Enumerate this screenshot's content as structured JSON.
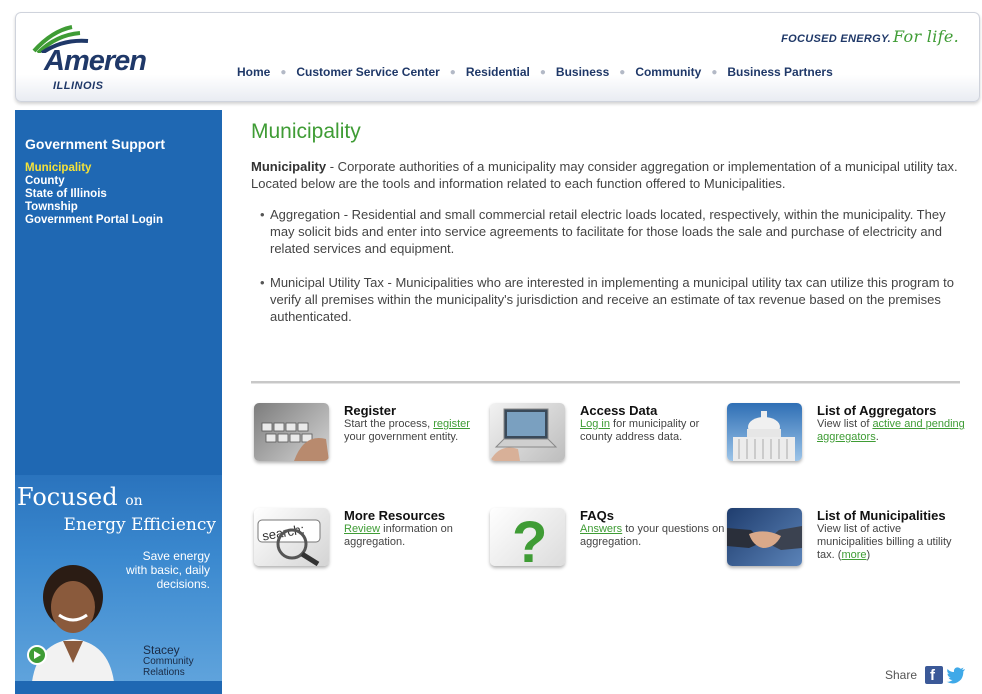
{
  "header": {
    "logo_text": "Ameren",
    "logo_sub": "ILLINOIS",
    "tagline": "FOCUSED ENERGY.",
    "tagline_script": "For life.",
    "nav": [
      "Home",
      "Customer Service Center",
      "Residential",
      "Business",
      "Community",
      "Business Partners"
    ]
  },
  "sidebar": {
    "title": "Government Support",
    "items": [
      "Municipality",
      "County",
      "State of Illinois",
      "Township",
      "Government Portal Login"
    ],
    "promo": {
      "focused": "Focused",
      "on": "on",
      "energy_efficiency": "Energy Efficiency",
      "save_line1": "Save energy",
      "save_line2": "with basic, daily",
      "save_line3": "decisions.",
      "name": "Stacey",
      "role": "Community Relations"
    }
  },
  "main": {
    "title": "Municipality",
    "intro_bold": "Municipality",
    "intro_text": " - Corporate authorities of a municipality may consider aggregation or implementation of a municipal utility tax.  Located below are the tools and information related to each function offered to Municipalities.",
    "bullets": [
      "Aggregation - Residential and small commercial retail electric loads located, respectively, within the municipality.  They may solicit bids and enter into service agreements to facilitate for those loads the sale and purchase of electricity and related services and equipment.",
      "Municipal Utility Tax - Municipalities who are interested in implementing a municipal utility tax can utilize this program to verify all premises within the municipality's jurisdiction and receive an estimate of tax revenue based on the premises authenticated."
    ]
  },
  "tiles": {
    "register": {
      "title": "Register",
      "pre": "Start the process, ",
      "link": "register",
      "post": " your government entity."
    },
    "access": {
      "title": "Access Data",
      "link": "Log in",
      "post": " for municipality or county address data."
    },
    "aggregators": {
      "title": "List of Aggregators",
      "pre": "View list of ",
      "link": "active and pending aggregators",
      "post": "."
    },
    "resources": {
      "title": "More Resources",
      "link": "Review",
      "post": " information on aggregation."
    },
    "faqs": {
      "title": "FAQs",
      "link": "Answers",
      "post": " to your questions on aggregation."
    },
    "municipalities": {
      "title": "List of Municipalities",
      "pre": "View list of active municipalities billing a utility tax. (",
      "link": "more",
      "post": ")"
    }
  },
  "share": {
    "label": "Share"
  },
  "colors": {
    "brand_blue": "#1f68b3",
    "accent_green": "#3f9c35",
    "navy": "#1f3868"
  }
}
